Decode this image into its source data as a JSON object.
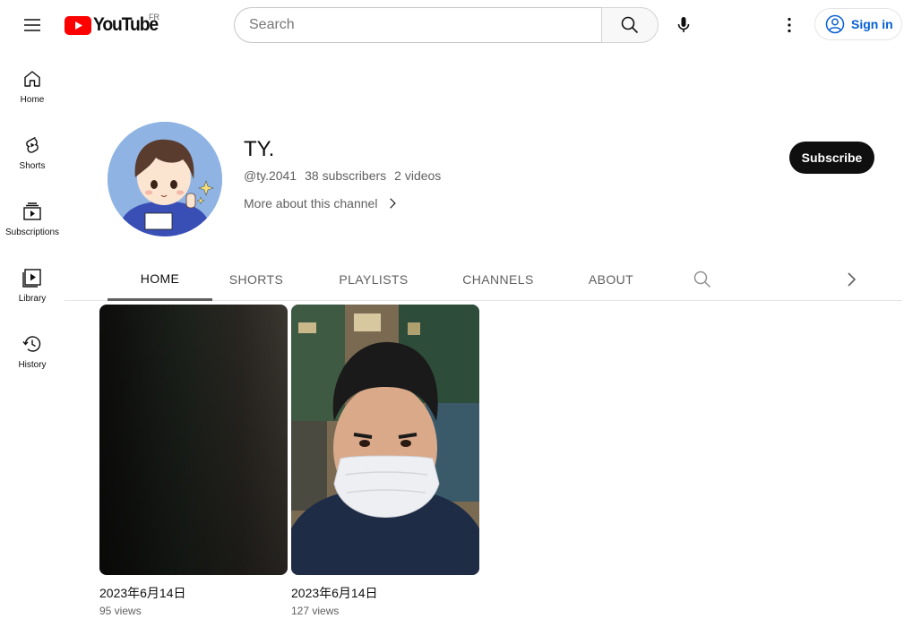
{
  "header": {
    "logo_text": "YouTube",
    "country_code": "FR",
    "search_placeholder": "Search",
    "sign_in_label": "Sign in"
  },
  "sidebar": {
    "items": [
      {
        "label": "Home",
        "icon": "home-icon"
      },
      {
        "label": "Shorts",
        "icon": "shorts-icon"
      },
      {
        "label": "Subscriptions",
        "icon": "subscriptions-icon"
      },
      {
        "label": "Library",
        "icon": "library-icon"
      },
      {
        "label": "History",
        "icon": "history-icon"
      }
    ]
  },
  "channel": {
    "name": "TY.",
    "handle": "@ty.2041",
    "subscribers": "38 subscribers",
    "videos": "2 videos",
    "more_about": "More about this channel",
    "subscribe_label": "Subscribe"
  },
  "tabs": [
    {
      "label": "HOME",
      "active": true
    },
    {
      "label": "SHORTS",
      "active": false
    },
    {
      "label": "PLAYLISTS",
      "active": false
    },
    {
      "label": "CHANNELS",
      "active": false
    },
    {
      "label": "ABOUT",
      "active": false
    }
  ],
  "shorts": [
    {
      "title": "2023年6月14日",
      "views": "95 views"
    },
    {
      "title": "2023年6月14日",
      "views": "127 views"
    }
  ],
  "colors": {
    "brand_red": "#ff0000",
    "link_blue": "#065fd4",
    "text_primary": "#0f0f0f",
    "text_secondary": "#606060"
  }
}
